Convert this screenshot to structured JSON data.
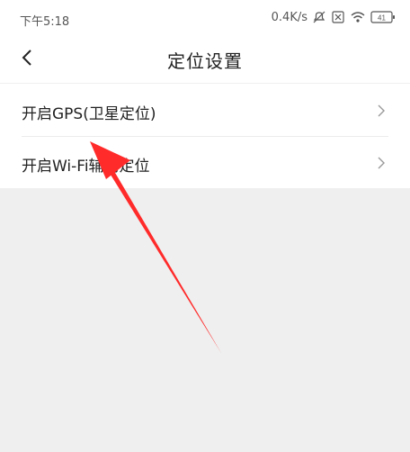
{
  "status_bar": {
    "time": "下午5:18",
    "network_speed": "0.4K/s",
    "icons": [
      "mute-bell-icon",
      "sim-off-icon",
      "wifi-icon",
      "battery-icon"
    ],
    "battery_level": "41"
  },
  "header": {
    "title": "定位设置",
    "back_icon": "chevron-left-icon"
  },
  "settings": {
    "items": [
      {
        "label": "开启GPS(卫星定位)"
      },
      {
        "label": "开启Wi-Fi辅助定位"
      }
    ]
  },
  "annotation": {
    "color": "#ff2a2a"
  }
}
